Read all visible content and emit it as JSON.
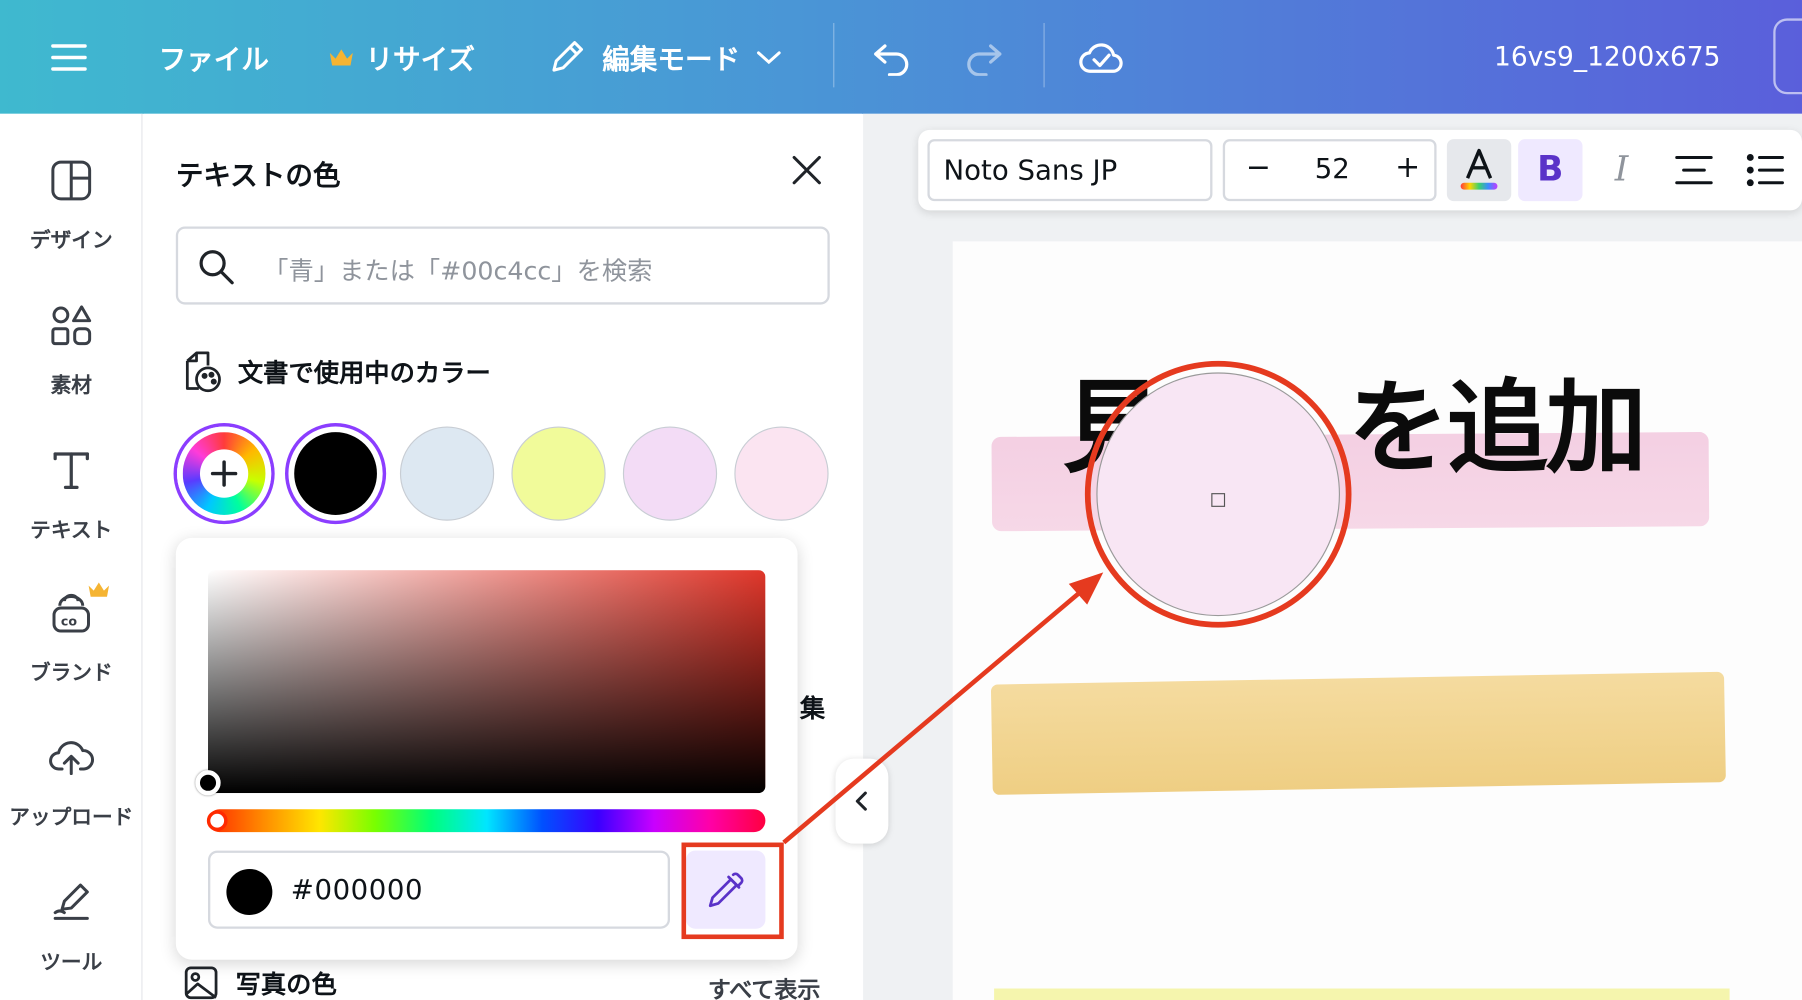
{
  "topbar": {
    "file_label": "ファイル",
    "resize_label": "リサイズ",
    "mode_label": "編集モード",
    "doc_title": "16vs9_1200x675",
    "accent_crown": "#f5b433"
  },
  "leftnav": {
    "items": [
      {
        "label": "デザイン",
        "icon": "layout-icon"
      },
      {
        "label": "素材",
        "icon": "shapes-icon"
      },
      {
        "label": "テキスト",
        "icon": "text-icon"
      },
      {
        "label": "ブランド",
        "icon": "brand-icon"
      },
      {
        "label": "アップロード",
        "icon": "cloud-upload-icon"
      },
      {
        "label": "ツール",
        "icon": "draw-tool-icon"
      }
    ]
  },
  "panel": {
    "title": "テキストの色",
    "search_placeholder": "「青」または「#00c4cc」を検索",
    "doc_colors_heading": "文書で使用中のカラー",
    "doc_colors": [
      "#000000",
      "#dde8f2",
      "#f1fb9a",
      "#f3dcf6",
      "#fbe4f1"
    ],
    "hex_value": "#000000",
    "partial_label": "集",
    "photo_colors_heading": "写真の色",
    "show_all": "すべて表示"
  },
  "toolbar": {
    "font_name": "Noto Sans JP",
    "font_size": "52",
    "bold_label": "B",
    "italic_label": "I",
    "minus": "−",
    "plus": "+"
  },
  "canvas": {
    "heading_visible_left": "見",
    "heading_visible_right": "を追加",
    "magnifier_color": "#f8e6f4",
    "annotation_color": "#e53a1f"
  }
}
